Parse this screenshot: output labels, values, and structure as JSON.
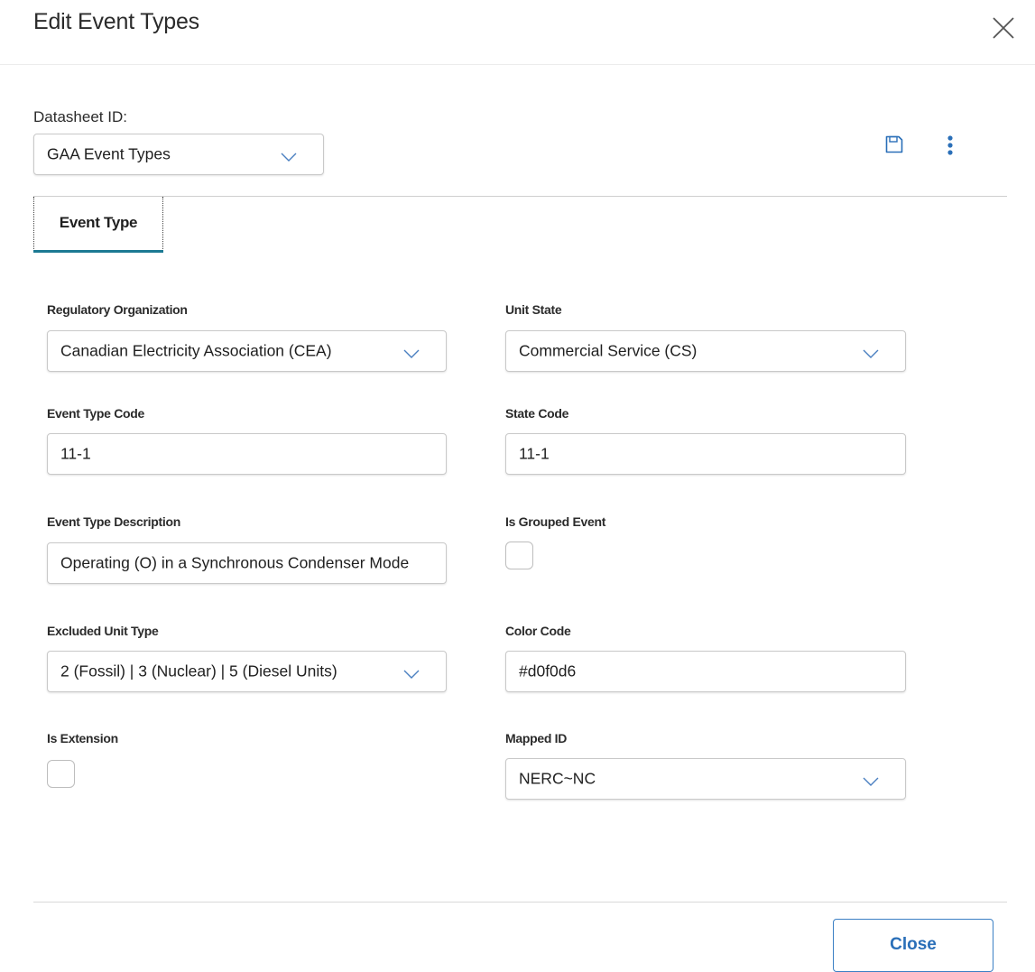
{
  "dialog": {
    "title": "Edit Event Types"
  },
  "datasheet": {
    "label": "Datasheet ID:",
    "value": "GAA Event Types"
  },
  "toolbar": {
    "save_icon": "save-icon",
    "more_icon": "more-vertical-icon",
    "accent_color": "#2a6fb8"
  },
  "tabs": [
    {
      "label": "Event Type",
      "active": true
    }
  ],
  "form": {
    "regulatory_organization": {
      "label": "Regulatory Organization",
      "value": "Canadian Electricity Association (CEA)"
    },
    "unit_state": {
      "label": "Unit State",
      "value": "Commercial Service (CS)"
    },
    "event_type_code": {
      "label": "Event Type Code",
      "value": "11-1"
    },
    "state_code": {
      "label": "State Code",
      "value": "11-1"
    },
    "event_type_description": {
      "label": "Event Type Description",
      "value": "Operating (O) in a Synchronous Condenser Modе"
    },
    "is_grouped_event": {
      "label": "Is Grouped Event",
      "checked": false
    },
    "excluded_unit_type": {
      "label": "Excluded Unit Type",
      "value": "2 (Fossil) | 3 (Nuclear) | 5 (Diesel Units)"
    },
    "color_code": {
      "label": "Color Code",
      "value": "#d0f0d6"
    },
    "is_extension": {
      "label": "Is Extension",
      "checked": false
    },
    "mapped_id": {
      "label": "Mapped ID",
      "value": "NERC~NC"
    }
  },
  "footer": {
    "close_label": "Close"
  },
  "colors": {
    "tab_underline": "#1c7a93",
    "button_text": "#2a6fb8"
  }
}
